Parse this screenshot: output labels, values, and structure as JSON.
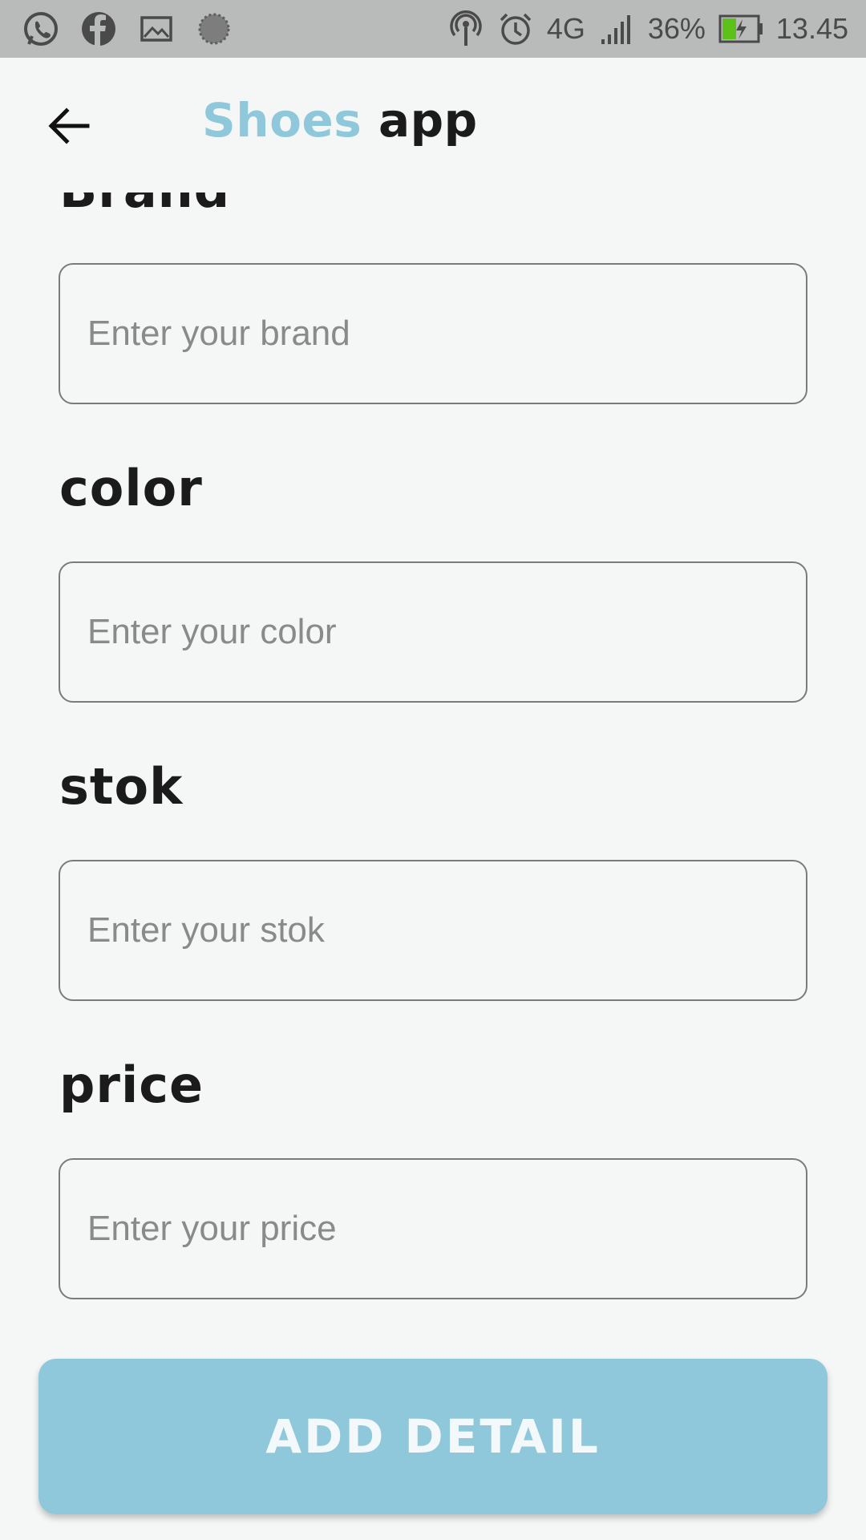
{
  "status_bar": {
    "left_icons": [
      "whatsapp-icon",
      "facebook-icon",
      "gallery-icon",
      "loading-icon"
    ],
    "right_icons": [
      "hotspot-icon",
      "alarm-icon"
    ],
    "network": "4G",
    "battery_percent": "36%",
    "time": "13.45"
  },
  "app_bar": {
    "back_icon": "arrow-left-icon",
    "title_accent": "Shoes",
    "title_rest": "app"
  },
  "form": {
    "fields": [
      {
        "label": "Brand",
        "placeholder": "Enter your brand",
        "value": ""
      },
      {
        "label": "color",
        "placeholder": "Enter your color",
        "value": ""
      },
      {
        "label": "stok",
        "placeholder": "Enter your stok",
        "value": ""
      },
      {
        "label": "price",
        "placeholder": "Enter your price",
        "value": ""
      }
    ]
  },
  "actions": {
    "add_detail_label": "ADD DETAIL"
  },
  "colors": {
    "accent": "#8fc8da",
    "background": "#f5f7f7",
    "status_bar": "#b9bbba",
    "text": "#1b1b1b",
    "battery_fill": "#5cc21a"
  }
}
